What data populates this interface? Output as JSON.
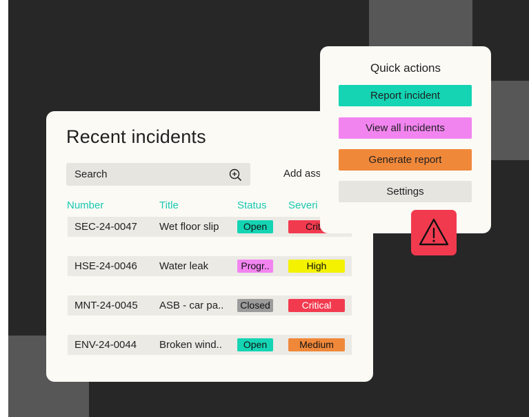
{
  "colors": {
    "background": "#272727",
    "tiles": "#575757",
    "card": "#fbfaf5",
    "accent_teal": "#18c8b0",
    "open": "#14d4b4",
    "progress": "#f284f0",
    "closed": "#9b9b9b",
    "critical": "#f23a4f",
    "high": "#f5f200",
    "medium": "#f0883a",
    "settings": "#e6e5e0"
  },
  "incidents": {
    "title": "Recent incidents",
    "search": {
      "placeholder": "Search",
      "icon": "zoom-in-icon"
    },
    "add_label": "Add ass",
    "columns": {
      "number": "Number",
      "title": "Title",
      "status": "Status",
      "severity": "Severi"
    },
    "rows": [
      {
        "number": "SEC-24-0047",
        "title": "Wet floor slip",
        "status": "Open",
        "severity": "Critic"
      },
      {
        "number": "HSE-24-0046",
        "title": "Water leak",
        "status": "Progr..",
        "severity": "High"
      },
      {
        "number": "MNT-24-0045",
        "title": "ASB - car pa..",
        "status": "Closed",
        "severity": "Critical"
      },
      {
        "number": "ENV-24-0044",
        "title": "Broken wind..",
        "status": "Open",
        "severity": "Medium"
      }
    ]
  },
  "quick_actions": {
    "title": "Quick actions",
    "report": "Report incident",
    "view_all": "View all incidents",
    "generate": "Generate report",
    "settings": "Settings"
  },
  "warning": {
    "icon": "warning-triangle-icon"
  }
}
